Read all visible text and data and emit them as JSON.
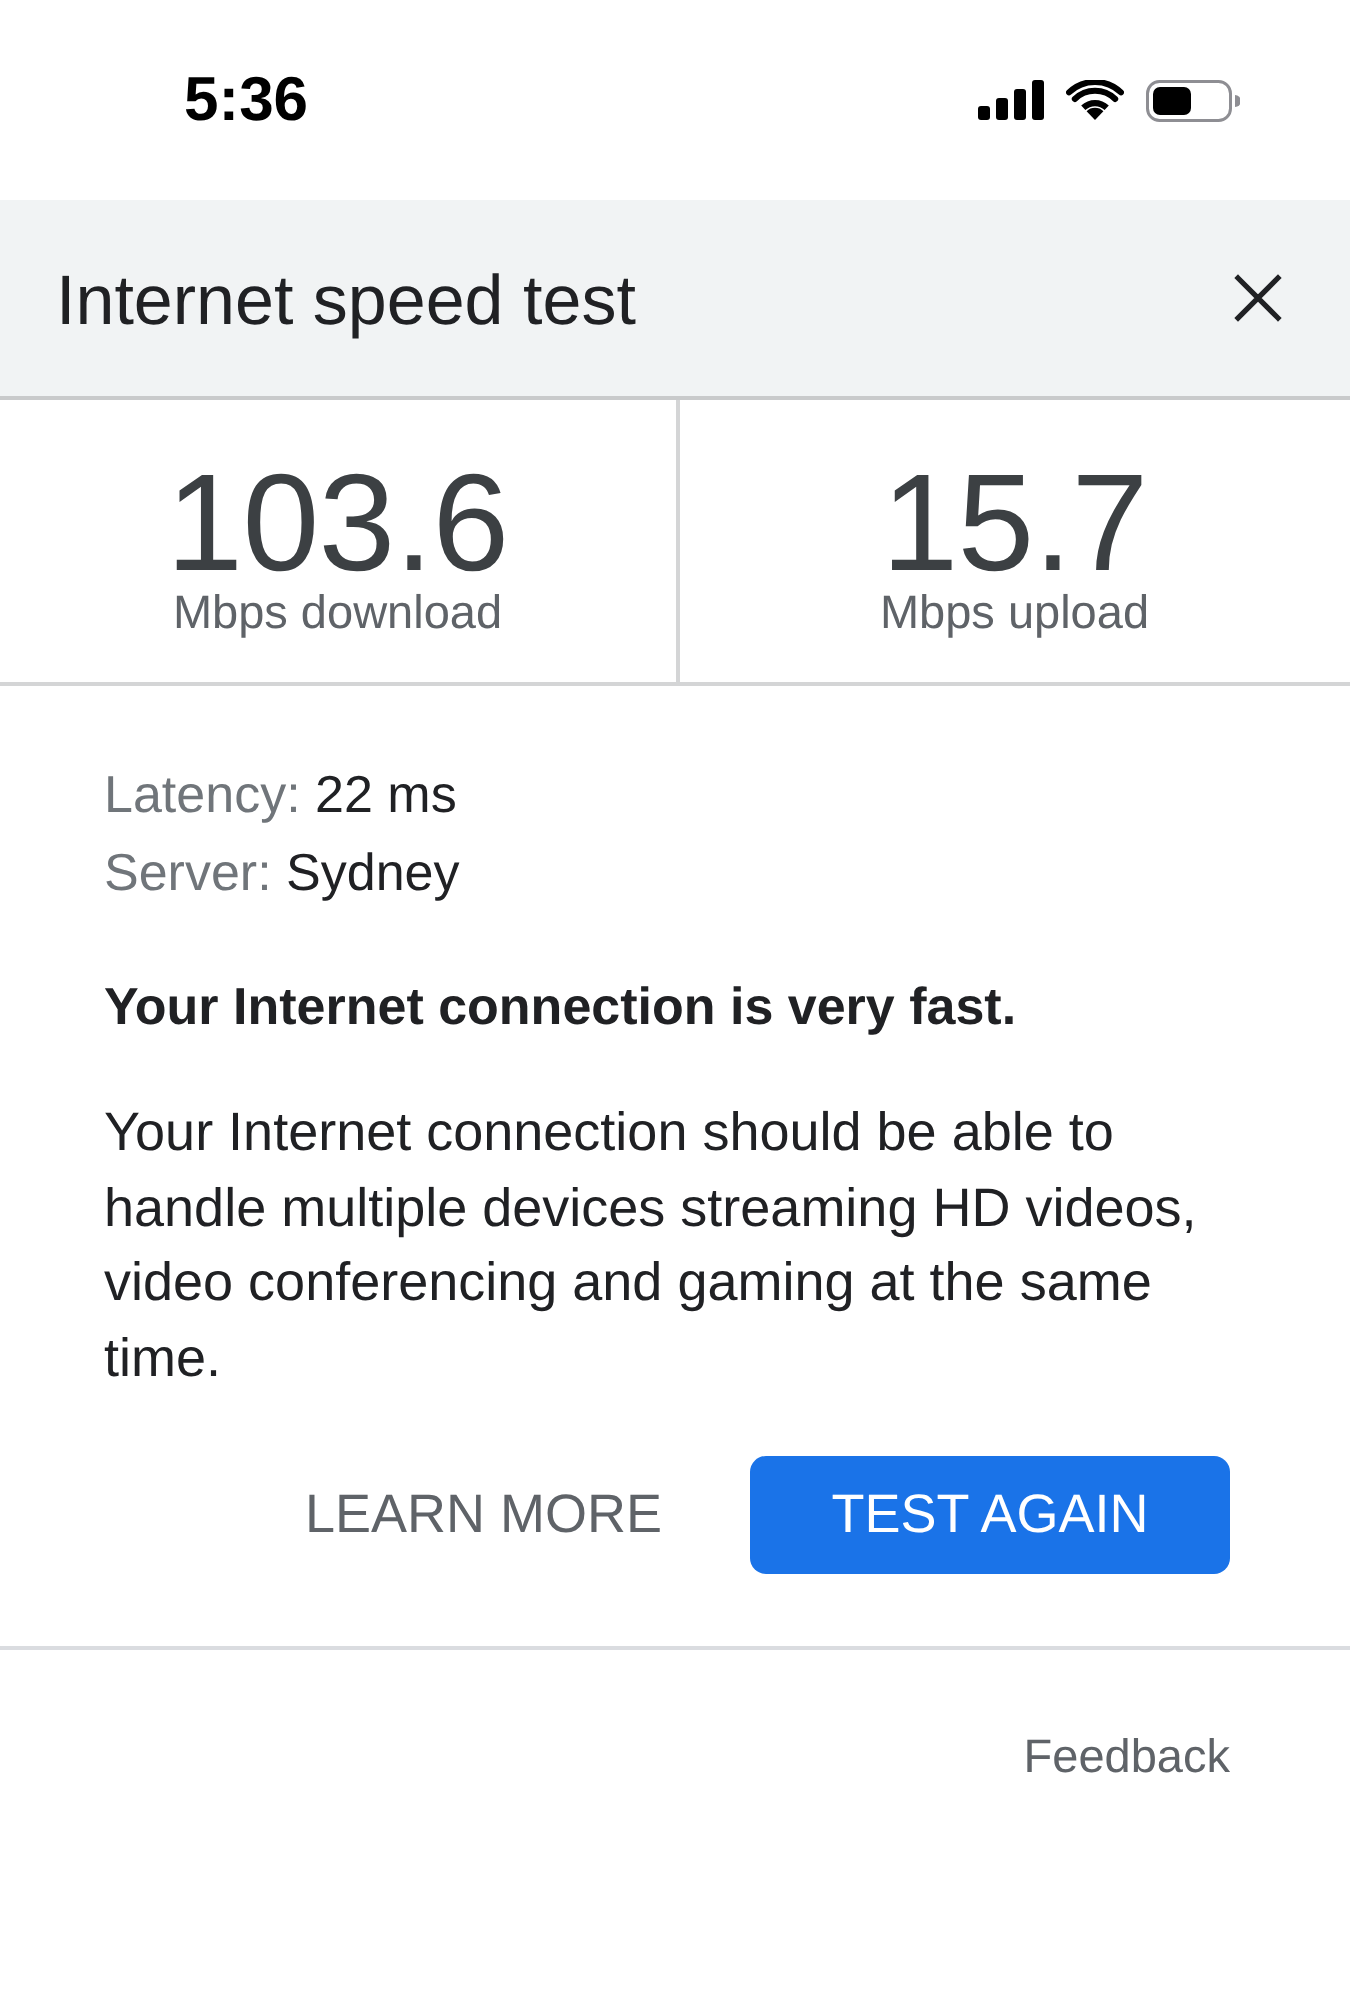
{
  "status_bar": {
    "time": "5:36"
  },
  "header": {
    "title": "Internet speed test"
  },
  "results": [
    {
      "value": "103.6",
      "unit": "Mbps download"
    },
    {
      "value": "15.7",
      "unit": "Mbps upload"
    }
  ],
  "details": [
    {
      "label": "Latency:",
      "value": "22 ms"
    },
    {
      "label": "Server:",
      "value": "Sydney"
    }
  ],
  "verdict": "Your Internet connection is very fast.",
  "description": "Your Internet connection should be able to handle multiple devices streaming HD videos, video conferencing and gaming at the same time.",
  "buttons": [
    {
      "label": "LEARN MORE",
      "kind": "text"
    },
    {
      "label": "TEST AGAIN",
      "kind": "filled"
    }
  ],
  "footer": {
    "link": "Feedback"
  }
}
